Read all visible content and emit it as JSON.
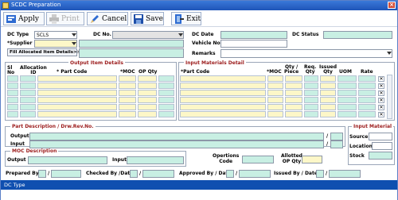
{
  "window": {
    "title": "SCDC Preparation"
  },
  "toolbar": {
    "apply": "Apply",
    "print": "Print",
    "cancel": "Cancel",
    "save": "Save",
    "exit": "Exit"
  },
  "header": {
    "dc_type_label": "DC Type",
    "dc_type_value": "SCLS",
    "dc_no_label": "DC No.",
    "dc_date_label": "DC Date",
    "dc_status_label": "DC Status",
    "supplier_label": "*Supplier",
    "vehicle_no_label": "Vehicle No.",
    "fill_button": "Fill Allocated Item Details>>",
    "remarks_label": "Remarks"
  },
  "output_items": {
    "title": "Output Item Details",
    "headers": {
      "sl_no": "Sl\nNo",
      "allocation_id": "Allocation\nID",
      "part_code": "* Part Code",
      "moc": "*MOC",
      "op_qty": "OP Qty"
    }
  },
  "input_materials": {
    "title": "Input Materials Detail",
    "headers": {
      "part_code": "*Part Code",
      "moc": "*MOC",
      "qty_piece": "Qty /\nPiece",
      "req_qty": "Req.\nQty",
      "issued_qty": "Issued\nQty",
      "uom": "UOM",
      "rate": "Rate"
    }
  },
  "part_description": {
    "title": "Part Description / Drw.Rev.No.",
    "output_label": "Output",
    "input_label": "Input",
    "slash": "/"
  },
  "input_material": {
    "title": "Input Material",
    "source_label": "Source",
    "location_label": "Location",
    "stock_label": "Stock"
  },
  "moc_description": {
    "title": "MOC Description",
    "output_label": "Output",
    "input_label": "Input",
    "operations_code_label": "Opertions\nCode",
    "allotted_op_qty_label": "Allotted\nOP Qty"
  },
  "footer": {
    "prepared_by": "Prepared By",
    "checked_by": "Checked By /Date",
    "approved_by": "Approved By / Date",
    "issued_by": "Issued By / Date",
    "slash": "/"
  },
  "status_bar": {
    "text": "DC Type"
  },
  "colors": {
    "title_bar": "#1f55b8",
    "status_bar": "#0f4fb0",
    "required_field": "#fdf7c8",
    "readonly_field": "#c8efe3",
    "section_title": "#9b1b1b"
  }
}
